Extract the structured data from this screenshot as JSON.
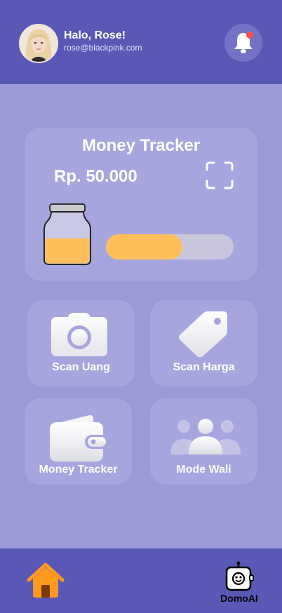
{
  "header": {
    "greeting": "Halo, Rose!",
    "email": "rose@blackpink.com",
    "notification_badge": true
  },
  "tracker": {
    "title": "Money Tracker",
    "amount": "Rp. 50.000",
    "progress_fraction": 0.6
  },
  "menu": [
    {
      "label": "Scan Uang",
      "icon": "camera-icon"
    },
    {
      "label": "Scan Harga",
      "icon": "price-tag-icon"
    },
    {
      "label": "Money Tracker",
      "icon": "wallet-icon"
    },
    {
      "label": "Mode Wali",
      "icon": "group-icon"
    }
  ],
  "nav": {
    "home_icon": "home-icon",
    "domo_label": "DomoAI"
  },
  "colors": {
    "header": "#5a58b7",
    "background": "#9b99d6",
    "card": "#a7a5dd",
    "accent": "#ffbe5a",
    "home": "#ff9a1f",
    "notification": "#ff4b4b"
  }
}
